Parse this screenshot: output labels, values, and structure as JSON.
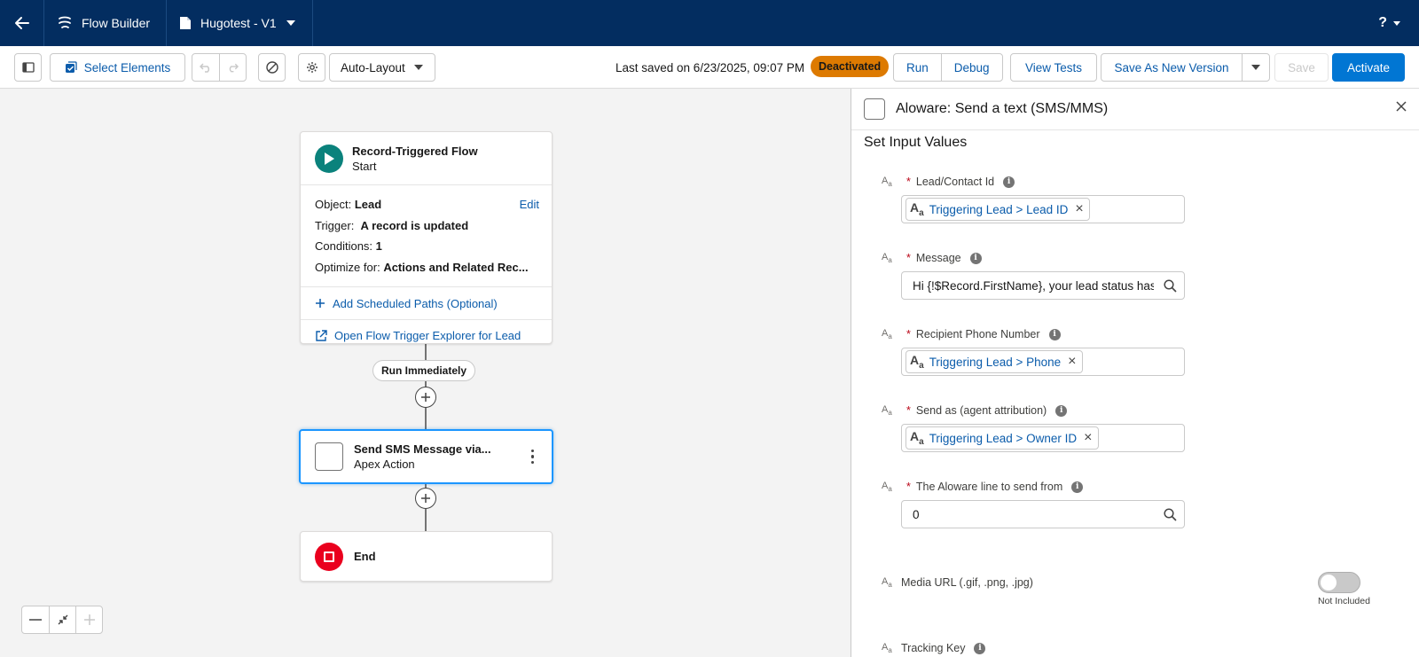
{
  "nav": {
    "app_name": "Flow Builder",
    "file_name": "Hugotest - V1",
    "help": "?"
  },
  "toolbar": {
    "select_elements": "Select Elements",
    "layout": "Auto-Layout",
    "last_saved": "Last saved on 6/23/2025, 09:07 PM",
    "status": "Deactivated",
    "run": "Run",
    "debug": "Debug",
    "view_tests": "View Tests",
    "save_as_new": "Save As New Version",
    "save": "Save",
    "activate": "Activate"
  },
  "canvas": {
    "start": {
      "title": "Record-Triggered Flow",
      "subtitle": "Start",
      "object_label": "Object:",
      "object_value": "Lead",
      "edit": "Edit",
      "trigger_label": "Trigger:",
      "trigger_value": "A record is updated",
      "conditions_label": "Conditions:",
      "conditions_value": "1",
      "optimize_label": "Optimize for:",
      "optimize_value": "Actions and Related Rec...",
      "add_paths": "Add Scheduled Paths (Optional)",
      "open_explorer": "Open Flow Trigger Explorer for Lead"
    },
    "run_immediately": "Run Immediately",
    "action": {
      "title": "Send SMS Message via...",
      "subtitle": "Apex Action"
    },
    "end": {
      "title": "End"
    }
  },
  "panel": {
    "title": "Aloware: Send a text (SMS/MMS)",
    "section": "Set Input Values",
    "fields": [
      {
        "label": "Lead/Contact Id",
        "chip": "Triggering Lead > Lead ID"
      },
      {
        "label": "Message",
        "value": "Hi {!$Record.FirstName}, your lead status has"
      },
      {
        "label": "Recipient Phone Number",
        "chip": "Triggering Lead > Phone"
      },
      {
        "label": "Send as (agent attribution)",
        "chip": "Triggering Lead > Owner ID"
      },
      {
        "label": "The Aloware line to send from",
        "value": "0"
      },
      {
        "label": "Media URL (.gif, .png, .jpg)",
        "toggle_label": "Not Included"
      },
      {
        "label": "Tracking Key"
      }
    ]
  },
  "colors": {
    "nav_bg": "#032d60",
    "brand_blue": "#0176d3",
    "link_blue": "#0b5cab",
    "warning": "#dd7a01",
    "start_green": "#0b827c",
    "end_red": "#ea001e"
  }
}
